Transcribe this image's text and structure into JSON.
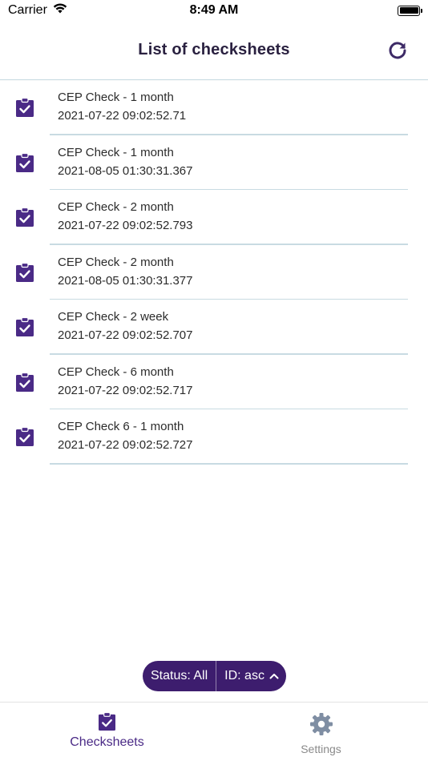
{
  "status_bar": {
    "carrier": "Carrier",
    "time": "8:49 AM"
  },
  "header": {
    "title": "List of checksheets",
    "refresh_icon": "refresh-icon"
  },
  "checksheets": [
    {
      "name": "CEP Check - 1 month",
      "timestamp": "2021-07-22 09:02:52.71"
    },
    {
      "name": "CEP Check - 1 month",
      "timestamp": "2021-08-05 01:30:31.367"
    },
    {
      "name": "CEP Check - 2 month",
      "timestamp": "2021-07-22 09:02:52.793"
    },
    {
      "name": "CEP Check - 2 month",
      "timestamp": "2021-08-05 01:30:31.377"
    },
    {
      "name": "CEP Check - 2 week",
      "timestamp": "2021-07-22 09:02:52.707"
    },
    {
      "name": "CEP Check - 6 month",
      "timestamp": "2021-07-22 09:02:52.717"
    },
    {
      "name": "CEP Check 6 - 1 month",
      "timestamp": "2021-07-22 09:02:52.727"
    }
  ],
  "filter": {
    "status_label": "Status: All",
    "sort_label": "ID: asc"
  },
  "tab_bar": {
    "checksheets_label": "Checksheets",
    "settings_label": "Settings"
  },
  "colors": {
    "accent": "#3d1d6e",
    "icon": "#4a2a86",
    "divider": "#c8dbe2",
    "inactive": "#8a8a8a"
  }
}
